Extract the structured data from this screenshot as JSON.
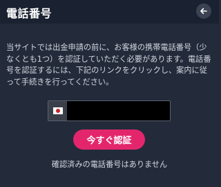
{
  "header": {
    "title": "電話番号",
    "back_icon": "arrow-left-icon"
  },
  "description": "当サイトでは出金申請の前に、お客様の携帯電話番号（少なくとも1つ）を認証していただく必要があります。電話番号を認証するには、下記のリンクをクリックし、案内に従って手続きを行ってください。",
  "phone": {
    "country_flag": "japan-flag-icon",
    "value": ""
  },
  "verify_button": {
    "label": "今すぐ認証",
    "color": "#e3266c"
  },
  "status_text": "確認済みの電話番号はありません"
}
